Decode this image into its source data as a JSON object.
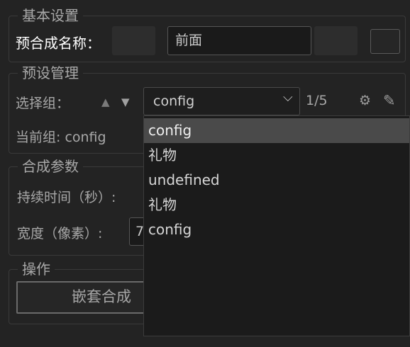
{
  "basic": {
    "legend": "基本设置",
    "comp_name_label": "预合成名称：",
    "comp_name_value": "前面"
  },
  "preset": {
    "legend": "预设管理",
    "select_group_label": "选择组：",
    "up_arrow": "▲",
    "down_arrow": "▼",
    "selected": "config",
    "page_counter": "1/5",
    "current_group_label": "当前组: config",
    "options": [
      "config",
      "礼物",
      "undefined",
      "礼物",
      "config"
    ],
    "chevron": "⌵",
    "gear_glyph": "⚙",
    "edit_glyph": "✎"
  },
  "params": {
    "legend": "合成参数",
    "duration_label": "持续时间（秒）:",
    "width_label": "宽度（像素）:",
    "width_value": "7"
  },
  "ops": {
    "legend": "操作",
    "nest_button": "嵌套合成"
  }
}
